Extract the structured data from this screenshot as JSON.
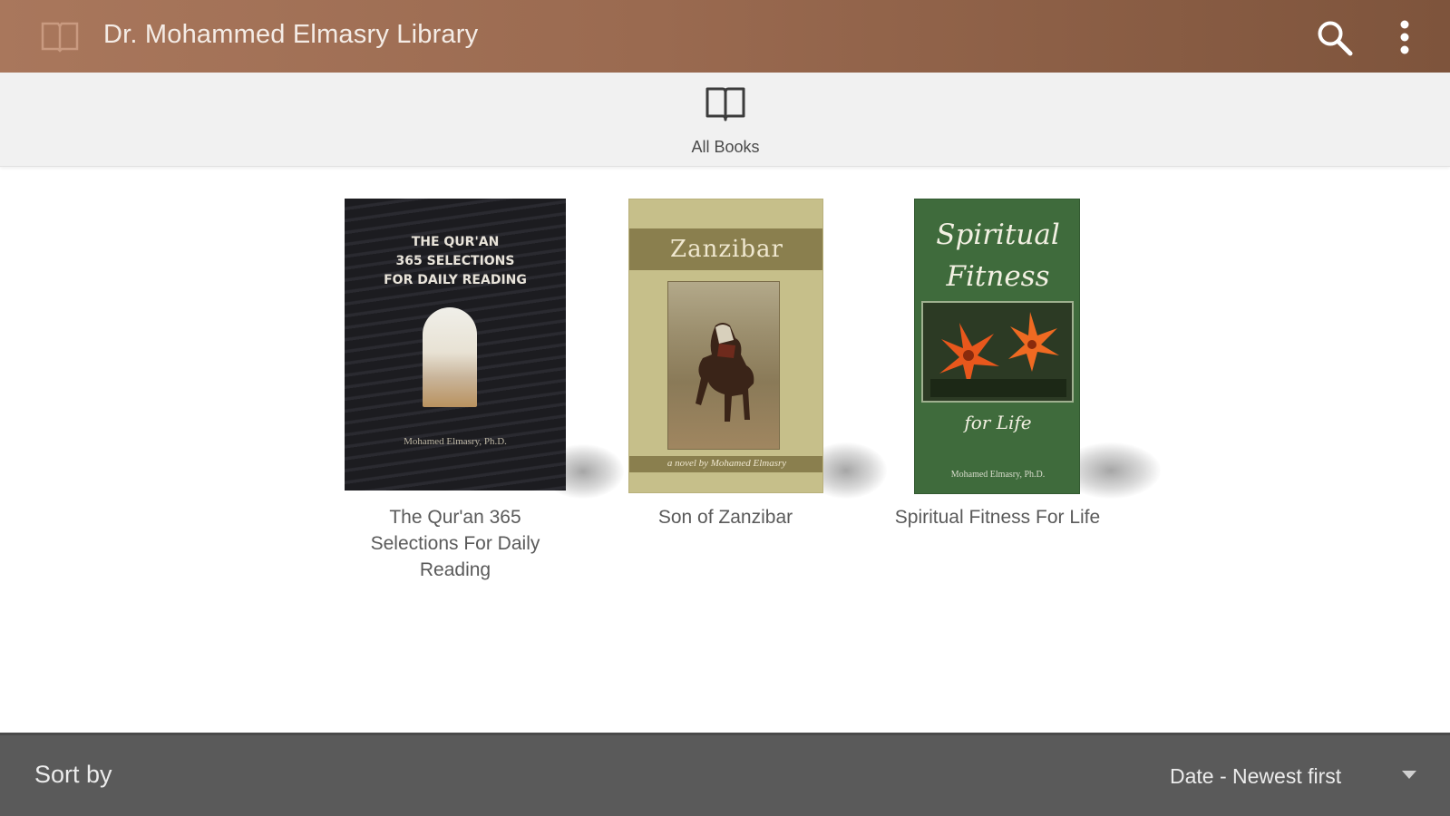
{
  "appbar": {
    "title": "Dr. Mohammed Elmasry Library",
    "logo_icon": "open-book-icon",
    "search_icon": "search-icon",
    "menu_icon": "more-vertical-icon",
    "colors": {
      "gradient_start": "#a9775c",
      "gradient_end": "#7e543c"
    }
  },
  "tabs": [
    {
      "label": "All Books",
      "icon": "open-book-icon"
    }
  ],
  "books": [
    {
      "title": "The Qur'an 365 Selections For Daily Reading",
      "title_lines": [
        "The Qur'an 365",
        "Selections For Daily",
        "Reading"
      ],
      "cover_lines": [
        "THE QUR'AN",
        "365 SELECTIONS",
        "FOR DAILY READING"
      ],
      "cover_author": "Mohamed Elmasry, Ph.D."
    },
    {
      "title": "Son of Zanzibar",
      "cover_title": "Zanzibar",
      "cover_author": "a novel by Mohamed Elmasry"
    },
    {
      "title": "Spiritual Fitness For Life",
      "cover_title_lines": [
        "Spiritual",
        "Fitness"
      ],
      "cover_subtitle": "for Life",
      "cover_author": "Mohamed Elmasry, Ph.D."
    }
  ],
  "sort": {
    "label": "Sort by",
    "selected": "Date - Newest first",
    "dropdown_icon": "dropdown-arrow-icon"
  }
}
